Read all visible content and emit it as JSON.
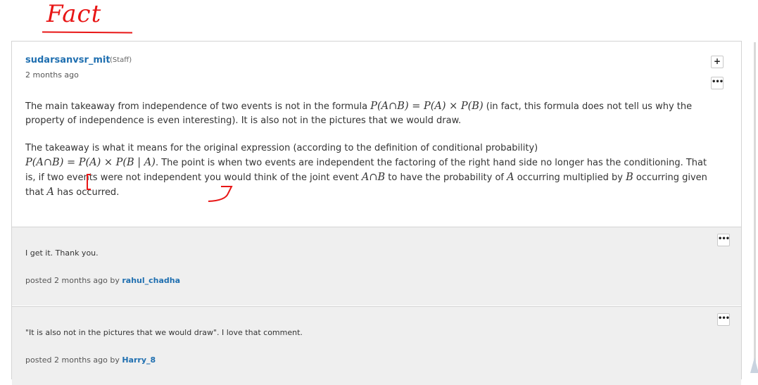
{
  "annotation": {
    "handwritten_label": "Fact"
  },
  "post": {
    "author": "sudarsanvsr_mit",
    "role": "(Staff)",
    "time": "2 months ago",
    "buttons": {
      "add_icon": "plus-icon",
      "more_icon": "ellipsis-icon"
    },
    "para1": {
      "t1": "The main takeaway from independence of two events is not in the formula ",
      "m1": "P(A∩B) = P(A) × P(B)",
      "t2": " (in fact, this formula does not tell us why the property of independence is even interesting). It is also not in the pictures that we would draw."
    },
    "para2": {
      "t1": "The takeaway is what it means for the original expression (according to the definition of conditional probability)",
      "m1": "P(A∩B) = P(A) × P(B | A)",
      "t2": ". The point is when two events are independent the factoring of the right hand side no longer has the conditioning. That is, if two events were not independent you would think of the joint event ",
      "m2": "A∩B",
      "t3": " to have the probability of ",
      "m3": "A",
      "t4": " occurring multiplied by ",
      "m4": "B",
      "t5": " occurring given that ",
      "m5": "A",
      "t6": " has occurred."
    }
  },
  "comments": [
    {
      "text": "I get it. Thank you.",
      "posted_prefix": "posted 2 months ago by ",
      "user": "rahul_chadha"
    },
    {
      "text": "\"It is also not in the pictures that we would draw\". I love that comment.",
      "posted_prefix": "posted 2 months ago by ",
      "user": "Harry_8"
    }
  ],
  "colors": {
    "link": "#1f6fb0",
    "annotation_red": "#e81616",
    "comment_bg": "#efefef"
  }
}
